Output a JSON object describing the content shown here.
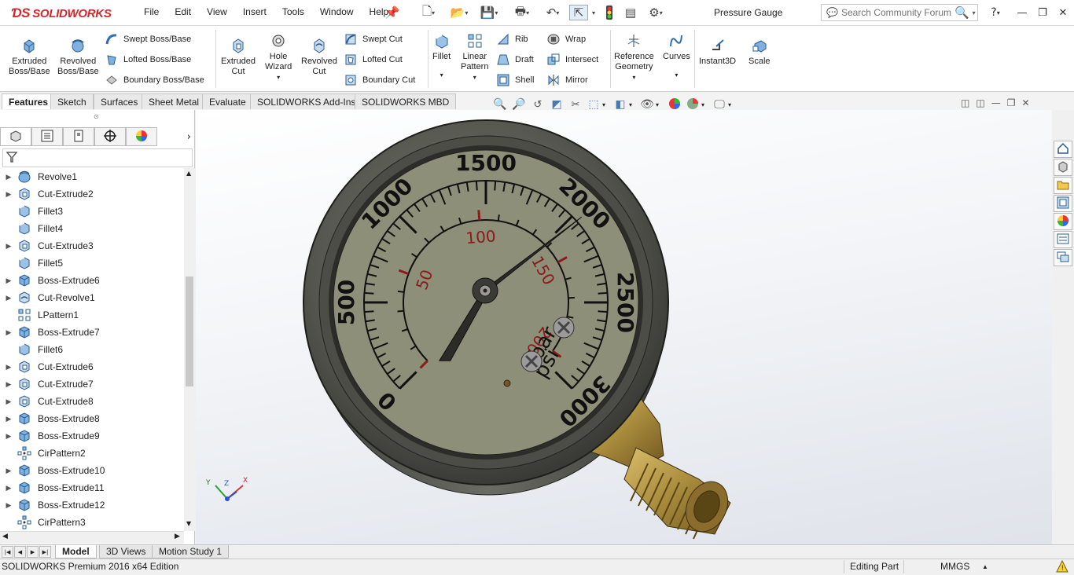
{
  "app": {
    "brand": "SOLIDWORKS",
    "document_title": "Pressure Gauge"
  },
  "menu": [
    "File",
    "Edit",
    "View",
    "Insert",
    "Tools",
    "Window",
    "Help"
  ],
  "search": {
    "placeholder": "Search Community Forum"
  },
  "help_label": "?",
  "ribbon": {
    "extruded_boss": "Extruded\nBoss/Base",
    "revolved_boss": "Revolved\nBoss/Base",
    "swept_boss": "Swept Boss/Base",
    "lofted_boss": "Lofted Boss/Base",
    "boundary_boss": "Boundary Boss/Base",
    "extruded_cut": "Extruded\nCut",
    "hole_wizard": "Hole\nWizard",
    "revolved_cut": "Revolved\nCut",
    "swept_cut": "Swept Cut",
    "lofted_cut": "Lofted Cut",
    "boundary_cut": "Boundary Cut",
    "fillet": "Fillet",
    "linear_pattern": "Linear\nPattern",
    "rib": "Rib",
    "draft": "Draft",
    "shell": "Shell",
    "wrap": "Wrap",
    "intersect": "Intersect",
    "mirror": "Mirror",
    "reference_geometry": "Reference\nGeometry",
    "curves": "Curves",
    "instant3d": "Instant3D",
    "scale": "Scale"
  },
  "command_tabs": [
    "Features",
    "Sketch",
    "Surfaces",
    "Sheet Metal",
    "Evaluate",
    "SOLIDWORKS Add-Ins",
    "SOLIDWORKS MBD"
  ],
  "feature_tree": [
    {
      "name": "Revolve1",
      "icon": "revolve-icon",
      "expandable": true
    },
    {
      "name": "Cut-Extrude2",
      "icon": "cut-extrude-icon",
      "expandable": true
    },
    {
      "name": "Fillet3",
      "icon": "fillet-icon",
      "expandable": false
    },
    {
      "name": "Fillet4",
      "icon": "fillet-icon",
      "expandable": false
    },
    {
      "name": "Cut-Extrude3",
      "icon": "cut-extrude-icon",
      "expandable": true
    },
    {
      "name": "Fillet5",
      "icon": "fillet-icon",
      "expandable": false
    },
    {
      "name": "Boss-Extrude6",
      "icon": "boss-extrude-icon",
      "expandable": true
    },
    {
      "name": "Cut-Revolve1",
      "icon": "cut-revolve-icon",
      "expandable": true
    },
    {
      "name": "LPattern1",
      "icon": "linear-pattern-icon",
      "expandable": false
    },
    {
      "name": "Boss-Extrude7",
      "icon": "boss-extrude-icon",
      "expandable": true
    },
    {
      "name": "Fillet6",
      "icon": "fillet-icon",
      "expandable": false
    },
    {
      "name": "Cut-Extrude6",
      "icon": "cut-extrude-icon",
      "expandable": true
    },
    {
      "name": "Cut-Extrude7",
      "icon": "cut-extrude-icon",
      "expandable": true
    },
    {
      "name": "Cut-Extrude8",
      "icon": "cut-extrude-icon",
      "expandable": true
    },
    {
      "name": "Boss-Extrude8",
      "icon": "boss-extrude-icon",
      "expandable": true
    },
    {
      "name": "Boss-Extrude9",
      "icon": "boss-extrude-icon",
      "expandable": true
    },
    {
      "name": "CirPattern2",
      "icon": "circular-pattern-icon",
      "expandable": false
    },
    {
      "name": "Boss-Extrude10",
      "icon": "boss-extrude-icon",
      "expandable": true
    },
    {
      "name": "Boss-Extrude11",
      "icon": "boss-extrude-icon",
      "expandable": true
    },
    {
      "name": "Boss-Extrude12",
      "icon": "boss-extrude-icon",
      "expandable": true
    },
    {
      "name": "CirPattern3",
      "icon": "circular-pattern-icon",
      "expandable": false
    }
  ],
  "gauge": {
    "psi_labels": [
      "0",
      "500",
      "1000",
      "1500",
      "2000",
      "2500",
      "3000"
    ],
    "bar_labels": [
      "50",
      "100",
      "150",
      "200"
    ],
    "unit_bar": "bar",
    "unit_psi": "psi",
    "needle_value_psi": 2000,
    "face_color": "#8e8f78",
    "bar_color": "#8c1a1a",
    "brass_color": "#a88a3c"
  },
  "triad": {
    "x": "X",
    "y": "Y",
    "z": "Z"
  },
  "bottom_tabs": [
    "Model",
    "3D Views",
    "Motion Study 1"
  ],
  "status": {
    "edition": "SOLIDWORKS Premium 2016 x64 Edition",
    "mode": "Editing Part",
    "units": "MMGS"
  }
}
